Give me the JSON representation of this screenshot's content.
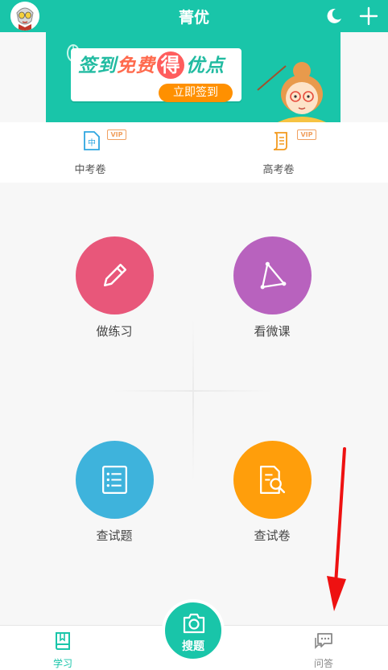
{
  "header": {
    "title": "菁优"
  },
  "banner": {
    "part1": "签到",
    "part2": "免费",
    "part3": "得",
    "part4": "优点",
    "button": "立即签到"
  },
  "papers": [
    {
      "label": "中考卷",
      "badge": "VIP",
      "icon_char": "中",
      "icon": "zhongkao-doc-icon"
    },
    {
      "label": "高考卷",
      "badge": "VIP",
      "icon": "gaokao-scroll-icon"
    }
  ],
  "features": [
    {
      "label": "做练习",
      "icon": "pencil-icon",
      "color": "#e8577a"
    },
    {
      "label": "看微课",
      "icon": "triangle-icon",
      "color": "#b862be"
    },
    {
      "label": "查试题",
      "icon": "list-doc-icon",
      "color": "#3eb3dc"
    },
    {
      "label": "查试卷",
      "icon": "doc-search-icon",
      "color": "#ff9e0b"
    }
  ],
  "bottom_nav": {
    "study": "学习",
    "search": "搜题",
    "qa": "问答"
  },
  "colors": {
    "brand": "#19c5a9",
    "accent": "#ff9000",
    "annotation_arrow": "#ee1111"
  }
}
